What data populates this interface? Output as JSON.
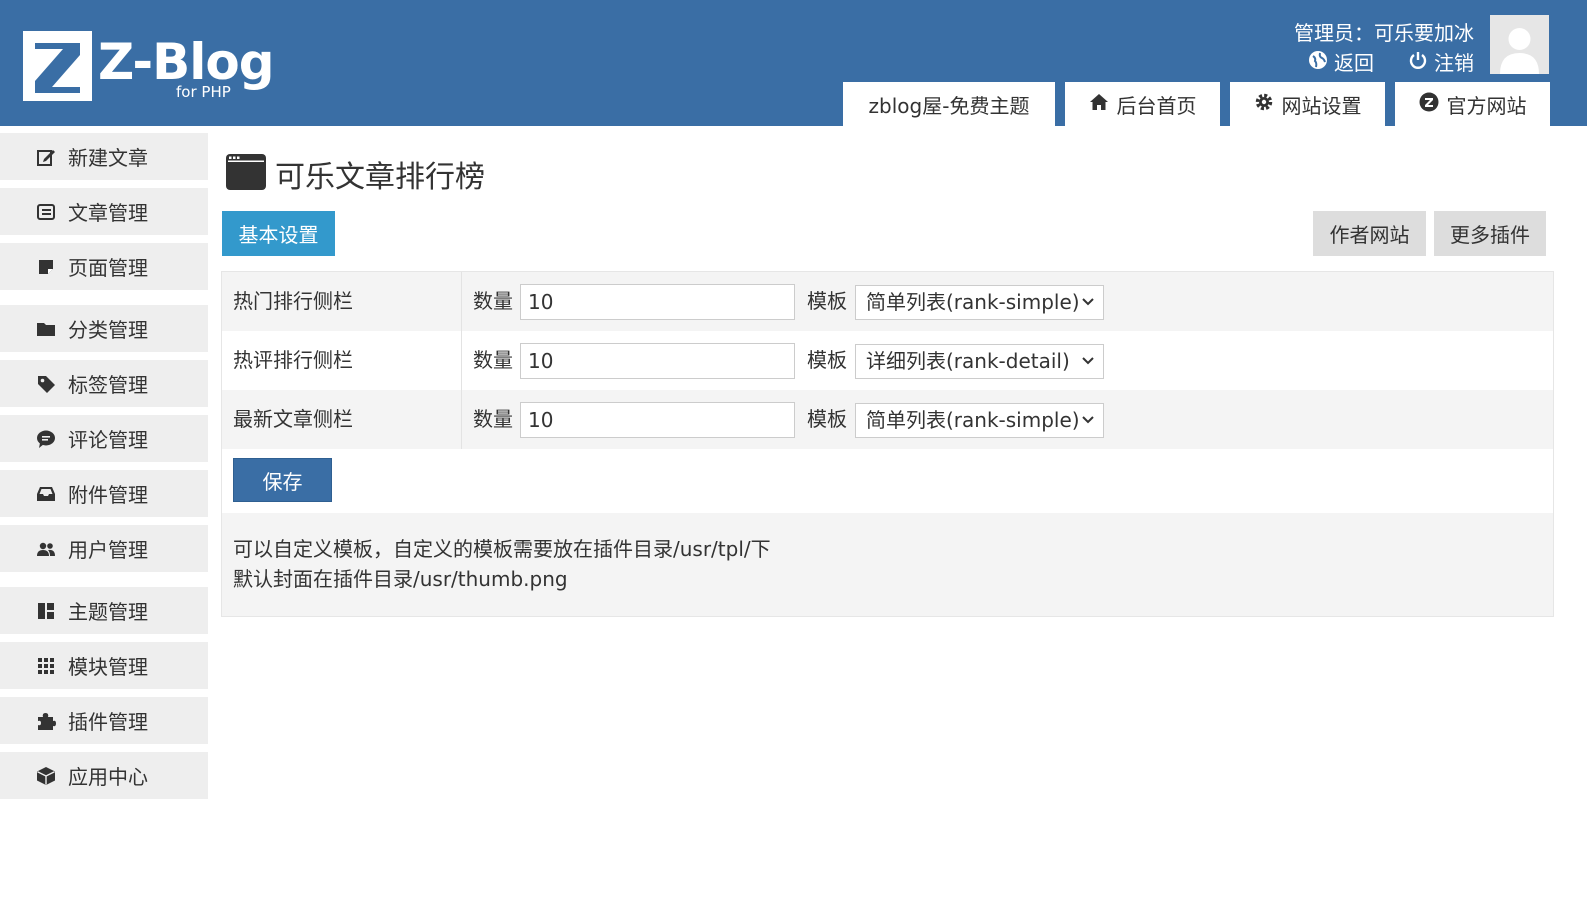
{
  "header": {
    "logo_text": "Z-Blog",
    "logo_sub": "for PHP",
    "user_label": "管理员：可乐要加冰",
    "back_label": "返回",
    "logout_label": "注销",
    "brand_color": "#3a6ea5",
    "tabs": [
      {
        "label": "zblog屋-免费主题",
        "icon": ""
      },
      {
        "label": "后台首页",
        "icon": "home-icon"
      },
      {
        "label": "网站设置",
        "icon": "gear-icon"
      },
      {
        "label": "官方网站",
        "icon": "zblog-icon"
      }
    ]
  },
  "sidebar": {
    "items": [
      {
        "label": "新建文章",
        "icon": "edit-icon"
      },
      {
        "label": "文章管理",
        "icon": "article-icon"
      },
      {
        "label": "页面管理",
        "icon": "page-icon"
      },
      {
        "label": "分类管理",
        "icon": "folder-icon"
      },
      {
        "label": "标签管理",
        "icon": "tag-icon"
      },
      {
        "label": "评论管理",
        "icon": "comment-icon"
      },
      {
        "label": "附件管理",
        "icon": "inbox-icon"
      },
      {
        "label": "用户管理",
        "icon": "users-icon"
      },
      {
        "label": "主题管理",
        "icon": "layout-icon"
      },
      {
        "label": "模块管理",
        "icon": "grid-icon"
      },
      {
        "label": "插件管理",
        "icon": "puzzle-icon"
      },
      {
        "label": "应用中心",
        "icon": "box-icon"
      }
    ]
  },
  "main": {
    "title": "可乐文章排行榜",
    "tab_basic": "基本设置",
    "author_site": "作者网站",
    "more_plugins": "更多插件",
    "accent_color": "#3399cc",
    "rows": [
      {
        "label": "热门排行侧栏",
        "qty_label": "数量",
        "qty_value": "10",
        "tpl_label": "模板",
        "tpl_value": "简单列表(rank-simple)"
      },
      {
        "label": "热评排行侧栏",
        "qty_label": "数量",
        "qty_value": "10",
        "tpl_label": "模板",
        "tpl_value": "详细列表(rank-detail)"
      },
      {
        "label": "最新文章侧栏",
        "qty_label": "数量",
        "qty_value": "10",
        "tpl_label": "模板",
        "tpl_value": "简单列表(rank-simple)"
      }
    ],
    "save_label": "保存",
    "notes": [
      "可以自定义模板，自定义的模板需要放在插件目录/usr/tpl/下",
      "默认封面在插件目录/usr/thumb.png"
    ]
  }
}
